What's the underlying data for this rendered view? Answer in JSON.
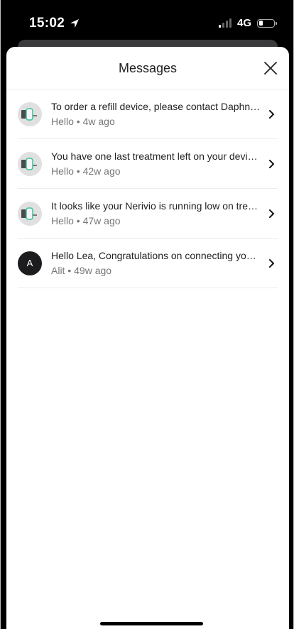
{
  "status_bar": {
    "time": "15:02",
    "network": "4G",
    "location_icon": "location-arrow-icon",
    "battery_level": 0.25
  },
  "sheet": {
    "title": "Messages",
    "close_icon": "close-icon"
  },
  "messages": [
    {
      "title": "To order a refill device, please contact Daphne...",
      "sender": "Hello",
      "age": "4w ago",
      "avatar": "device-image"
    },
    {
      "title": "You have one last treatment left on your device...",
      "sender": "Hello",
      "age": "42w ago",
      "avatar": "device-image"
    },
    {
      "title": "It looks like your Nerivio is running low on treat...",
      "sender": "Hello",
      "age": "47w ago",
      "avatar": "device-image"
    },
    {
      "title": "Hello Lea, Congratulations on connecting your...",
      "sender": "Alit",
      "age": "49w ago",
      "avatar_letter": "A"
    }
  ],
  "colors": {
    "accent_device": "#37c4a1",
    "avatar_dark": "#1c1c1e"
  }
}
